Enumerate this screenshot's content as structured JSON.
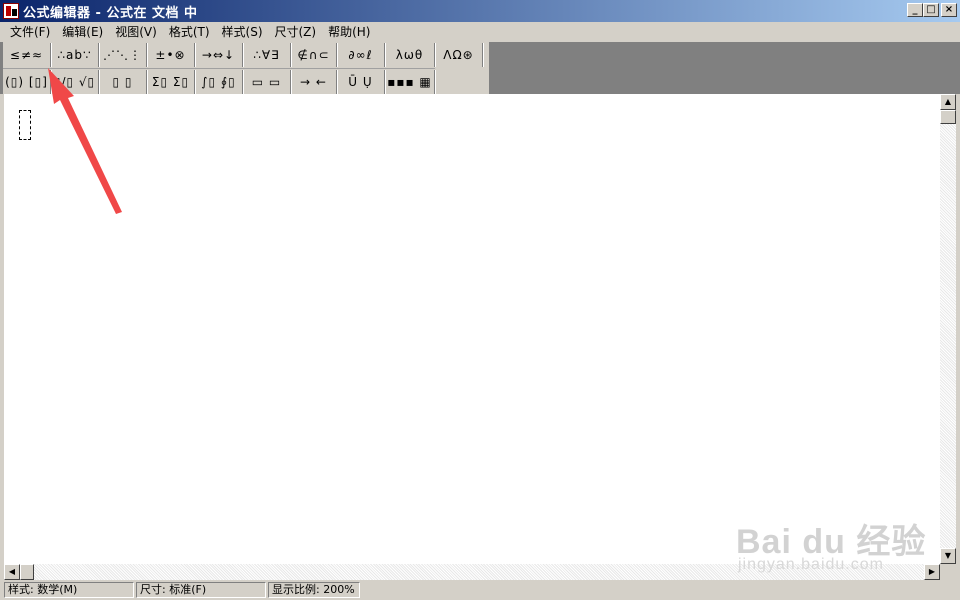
{
  "window": {
    "title": "公式编辑器 - 公式在 文档 中",
    "buttons": {
      "minimize": "_",
      "maximize": "□",
      "close": "×"
    }
  },
  "menu": [
    "文件(F)",
    "编辑(E)",
    "视图(V)",
    "格式(T)",
    "样式(S)",
    "尺寸(Z)",
    "帮助(H)"
  ],
  "toolbar": {
    "row1": [
      "≤≠≈",
      "∴ab∵",
      "⋰⋱⋮",
      "±•⊗",
      "→⇔↓",
      "∴∀∃",
      "∉∩⊂",
      "∂∞ℓ",
      "λωθ",
      "ΛΩ⊛"
    ],
    "row2": [
      "(▯) [▯]",
      "▯/▯ √▯",
      "▯ ▯",
      "Σ▯ Σ▯",
      "∫▯ ∮▯",
      "▭ ▭",
      "→ ←",
      "Ū Ụ",
      "▪▪▪ ▦"
    ]
  },
  "scroll": {
    "up": "▲",
    "down": "▼",
    "left": "◀",
    "right": "▶"
  },
  "status": {
    "style": "样式: 数学(M)",
    "size": "尺寸: 标准(F)",
    "zoom": "显示比例: 200%"
  },
  "watermark": {
    "brand": "Bai du 经验",
    "url": "jingyan.baidu.com"
  },
  "annotation_color": "#f04848",
  "icons": [
    "app-icon",
    "annotation-arrow-icon"
  ]
}
